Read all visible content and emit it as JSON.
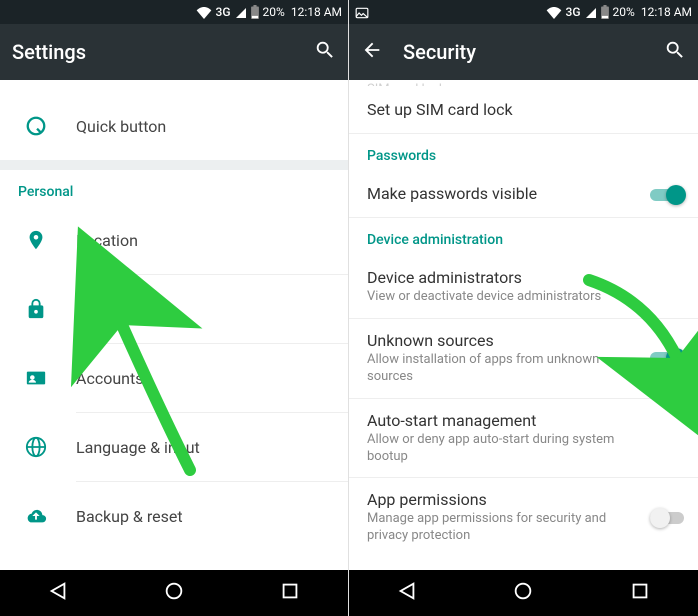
{
  "statusbar": {
    "network": "3G",
    "battery_pct": "20%",
    "time": "12:18 AM"
  },
  "left": {
    "title": "Settings",
    "rows": {
      "quick": "Quick button",
      "section_personal": "Personal",
      "location": "Location",
      "security": "Security",
      "accounts": "Accounts",
      "language": "Language & input",
      "backup": "Backup & reset"
    }
  },
  "right": {
    "title": "Security",
    "cutoff_header": "SIM card lock",
    "sim": {
      "title": "Set up SIM card lock"
    },
    "section_passwords": "Passwords",
    "pw_visible": {
      "title": "Make passwords visible"
    },
    "section_device": "Device administration",
    "dev_admin": {
      "title": "Device administrators",
      "sub": "View or deactivate device administrators"
    },
    "unknown": {
      "title": "Unknown sources",
      "sub": "Allow installation of apps from unknown sources"
    },
    "autostart": {
      "title": "Auto-start management",
      "sub": "Allow or deny app auto-start during system bootup"
    },
    "appperm": {
      "title": "App permissions",
      "sub": "Manage app permissions for security and privacy protection"
    }
  }
}
